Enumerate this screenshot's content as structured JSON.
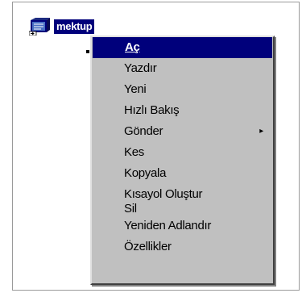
{
  "desktop": {
    "file_label": "mektup",
    "file_icon": "document-icon"
  },
  "context_menu": {
    "items": [
      {
        "label": "Aç",
        "selected": true
      },
      {
        "label": "Yazdır"
      },
      {
        "label": "Yeni"
      },
      {
        "label": "Hızlı Bakış"
      },
      {
        "label": "Gönder",
        "submenu": true
      },
      {
        "label": "Kes"
      },
      {
        "label": "Kopyala"
      },
      {
        "label": "Kısayol Oluştur"
      },
      {
        "label": "Sil"
      },
      {
        "label": "Yeniden Adlandır"
      },
      {
        "label": "Özellikler"
      }
    ],
    "submenu_arrow": "▸"
  },
  "colors": {
    "highlight": "#00007b",
    "menu_face": "#c0c0c0"
  }
}
